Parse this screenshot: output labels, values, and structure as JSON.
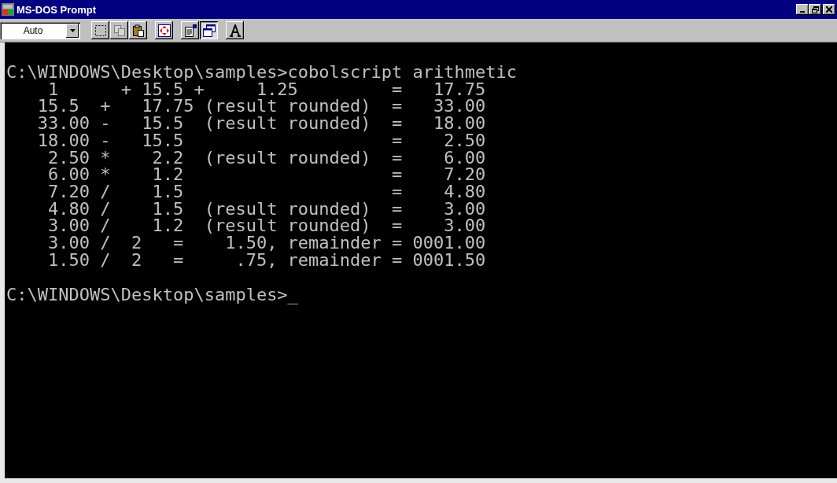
{
  "window": {
    "title": "MS-DOS Prompt"
  },
  "toolbar": {
    "font_size": "Auto",
    "button_groups": [
      [
        {
          "kind": "mark",
          "disabled": false,
          "pressed": false
        },
        {
          "kind": "copy",
          "disabled": true,
          "pressed": false
        },
        {
          "kind": "paste",
          "disabled": false,
          "pressed": false
        }
      ],
      [
        {
          "kind": "fullscreen",
          "disabled": false,
          "pressed": false
        }
      ],
      [
        {
          "kind": "properties",
          "disabled": false,
          "pressed": false
        },
        {
          "kind": "background",
          "disabled": false,
          "pressed": true
        }
      ],
      [
        {
          "kind": "font",
          "disabled": false,
          "pressed": false
        }
      ]
    ]
  },
  "console": {
    "command_line": "C:\\WINDOWS\\Desktop\\samples>cobolscript arithmetic",
    "output": [
      "    1      + 15.5 +     1.25         =   17.75",
      "   15.5  +   17.75 (result rounded)  =   33.00",
      "   33.00 -   15.5  (result rounded)  =   18.00",
      "   18.00 -   15.5                    =    2.50",
      "    2.50 *    2.2  (result rounded)  =    6.00",
      "    6.00 *    1.2                    =    7.20",
      "    7.20 /    1.5                    =    4.80",
      "    4.80 /    1.5  (result rounded)  =    3.00",
      "    3.00 /    1.2  (result rounded)  =    3.00",
      "    3.00 /  2   =    1.50, remainder = 0001.00",
      "    1.50 /  2   =     .75, remainder = 0001.50"
    ],
    "prompt": "C:\\WINDOWS\\Desktop\\samples>_"
  }
}
